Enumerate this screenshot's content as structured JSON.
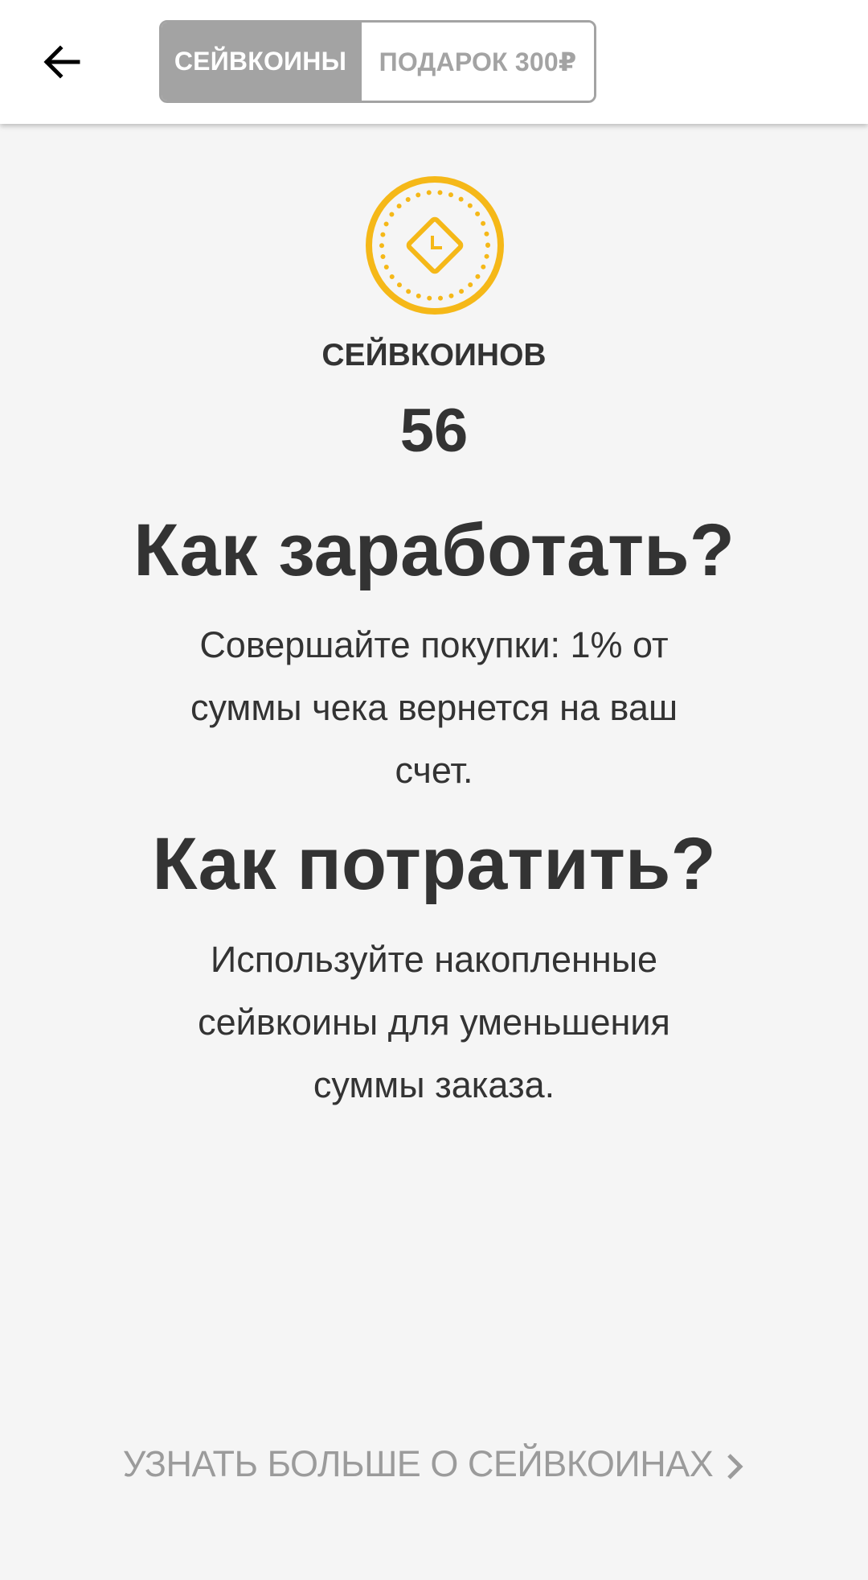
{
  "header": {
    "back_icon": "arrow-left-icon",
    "tabs": [
      {
        "label": "СЕЙВКОИНЫ",
        "active": true
      },
      {
        "label": "ПОДАРОК 300₽",
        "active": false
      }
    ]
  },
  "balance": {
    "icon": "coin-icon",
    "label": "СЕЙВКОИНОВ",
    "value": "56"
  },
  "earn": {
    "title": "Как заработать?",
    "text": "Совершайте покупки: 1% от суммы чека вернется на ваш счет."
  },
  "spend": {
    "title": "Как потратить?",
    "text": "Используйте накопленные сейвкоины для уменьшения суммы заказа."
  },
  "footer": {
    "learn_more": "УЗНАТЬ БОЛЬШЕ О СЕЙВКОИНАХ",
    "chevron_icon": "chevron-right-icon"
  },
  "colors": {
    "accent_coin": "#f5b818",
    "segment_active": "#a3a3a3",
    "text_dark": "#333333",
    "text_muted": "#9b9b9b",
    "background": "#f5f5f5"
  }
}
